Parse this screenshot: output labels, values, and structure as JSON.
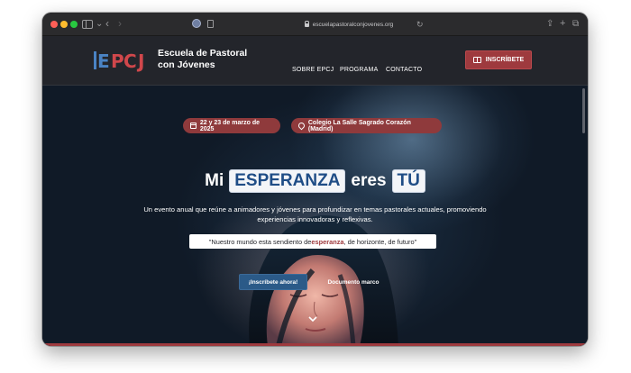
{
  "browser": {
    "url": "escuelapastoralconjovenes.org"
  },
  "header": {
    "logo_line1": "Escuela de Pastoral",
    "logo_line2": "con Jóvenes",
    "nav": [
      {
        "label": "SOBRE EPCJ"
      },
      {
        "label": "PROGRAMA"
      },
      {
        "label": "CONTACTO"
      }
    ],
    "cta_label": "INSCRÍBETE"
  },
  "hero": {
    "date_badge": "22 y 23 de marzo de 2025",
    "place_badge": "Colegio La Salle Sagrado Corazón (Madrid)",
    "headline_part1": "Mi",
    "headline_box1": "ESPERANZA",
    "headline_part2": "eres",
    "headline_box2": "TÚ",
    "subtitle": "Un evento anual que reúne a animadores y jóvenes para profundizar en temas pastorales actuales, promoviendo experiencias innovadoras y reflexivas.",
    "quote_before": "\"Nuestro mundo esta sendiento de ",
    "quote_highlight": "esperanza",
    "quote_after": ", de horizonte, de futuro\"",
    "primary_button": "¡Inscríbete ahora!",
    "secondary_button": "Documento marco"
  },
  "colors": {
    "accent_red": "#9e3a3e",
    "accent_blue": "#2b5a88",
    "header_bg": "#23252b"
  },
  "icons": [
    "sidebar-icon",
    "chevron-left-icon",
    "chevron-right-icon",
    "lock-icon",
    "reload-icon",
    "share-icon",
    "new-tab-icon",
    "tabs-icon",
    "ticket-icon",
    "calendar-icon",
    "map-pin-icon",
    "chevron-down-icon"
  ]
}
